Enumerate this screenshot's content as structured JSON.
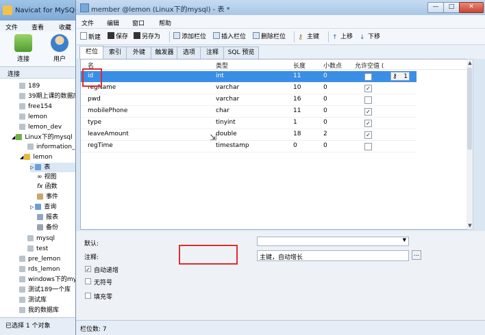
{
  "back_window": {
    "title": "Navicat for MySQL",
    "menu": [
      "文件",
      "查看",
      "收藏"
    ],
    "toolbar": [
      {
        "label": "连接",
        "icon": "connect-icon"
      },
      {
        "label": "用户",
        "icon": "user-icon"
      }
    ],
    "connections_header": "连接",
    "tree": [
      {
        "label": "189",
        "kind": "db"
      },
      {
        "label": "39期上课的数据库",
        "kind": "db"
      },
      {
        "label": "free154",
        "kind": "db"
      },
      {
        "label": "lemon",
        "kind": "db"
      },
      {
        "label": "lemon_dev",
        "kind": "db"
      },
      {
        "label": "Linux下的mysql",
        "kind": "server"
      },
      {
        "label": "information_",
        "kind": "db"
      },
      {
        "label": "lemon",
        "kind": "db-open"
      },
      {
        "label": "表",
        "kind": "folder"
      },
      {
        "label": "视图",
        "kind": "view"
      },
      {
        "label": "函数",
        "kind": "func"
      },
      {
        "label": "事件",
        "kind": "event"
      },
      {
        "label": "查询",
        "kind": "folder"
      },
      {
        "label": "报表",
        "kind": "report"
      },
      {
        "label": "备份",
        "kind": "backup"
      },
      {
        "label": "mysql",
        "kind": "db"
      },
      {
        "label": "test",
        "kind": "db"
      },
      {
        "label": "pre_lemon",
        "kind": "db"
      },
      {
        "label": "rds_lemon",
        "kind": "db"
      },
      {
        "label": "windows下的mys",
        "kind": "db"
      },
      {
        "label": "测试189一个库",
        "kind": "db"
      },
      {
        "label": "测试库",
        "kind": "db"
      },
      {
        "label": "我的数据库",
        "kind": "db"
      }
    ],
    "status": "已选择 1 个对象"
  },
  "window": {
    "title": "member @lemon (Linux下的mysql) - 表 *",
    "controls": {
      "minimize": "—",
      "maximize": "□",
      "close": "✕"
    }
  },
  "menu": [
    "文件",
    "编辑",
    "窗口",
    "帮助"
  ],
  "toolbar": {
    "new": "新建",
    "save": "保存",
    "save_as": "另存为",
    "add_field": "添加栏位",
    "insert_field": "插入栏位",
    "delete_field": "删除栏位",
    "primary_key": "主键",
    "move_up": "上移",
    "move_down": "下移"
  },
  "tabs": [
    "栏位",
    "索引",
    "外键",
    "触发器",
    "选项",
    "注释",
    "SQL 预览"
  ],
  "active_tab": "栏位",
  "grid": {
    "headers": [
      "名",
      "类型",
      "长度",
      "小数点",
      "允许空值 ("
    ],
    "rows": [
      {
        "name": "id",
        "type": "int",
        "length": "11",
        "decimals": "0",
        "allow_null": false,
        "key": "1"
      },
      {
        "name": "regName",
        "type": "varchar",
        "length": "10",
        "decimals": "0",
        "allow_null": true,
        "key": ""
      },
      {
        "name": "pwd",
        "type": "varchar",
        "length": "16",
        "decimals": "0",
        "allow_null": false,
        "key": ""
      },
      {
        "name": "mobilePhone",
        "type": "char",
        "length": "11",
        "decimals": "0",
        "allow_null": true,
        "key": ""
      },
      {
        "name": "type",
        "type": "tinyint",
        "length": "1",
        "decimals": "0",
        "allow_null": true,
        "key": ""
      },
      {
        "name": "leaveAmount",
        "type": "double",
        "length": "18",
        "decimals": "2",
        "allow_null": true,
        "key": ""
      },
      {
        "name": "regTime",
        "type": "timestamp",
        "length": "0",
        "decimals": "0",
        "allow_null": false,
        "key": ""
      }
    ],
    "selected_row": 0
  },
  "props": {
    "default_label": "默认:",
    "default_value": "",
    "comment_label": "注释:",
    "comment_value": "主键，自动增长",
    "comment_more": "...",
    "auto_increment_label": "自动递增",
    "auto_increment": true,
    "unsigned_label": "无符号",
    "unsigned": false,
    "zerofill_label": "填充零",
    "zerofill": false
  },
  "status": "栏位数: 7",
  "colors": {
    "selection": "#3a8ee6",
    "highlight_box": "#e02b2b"
  }
}
